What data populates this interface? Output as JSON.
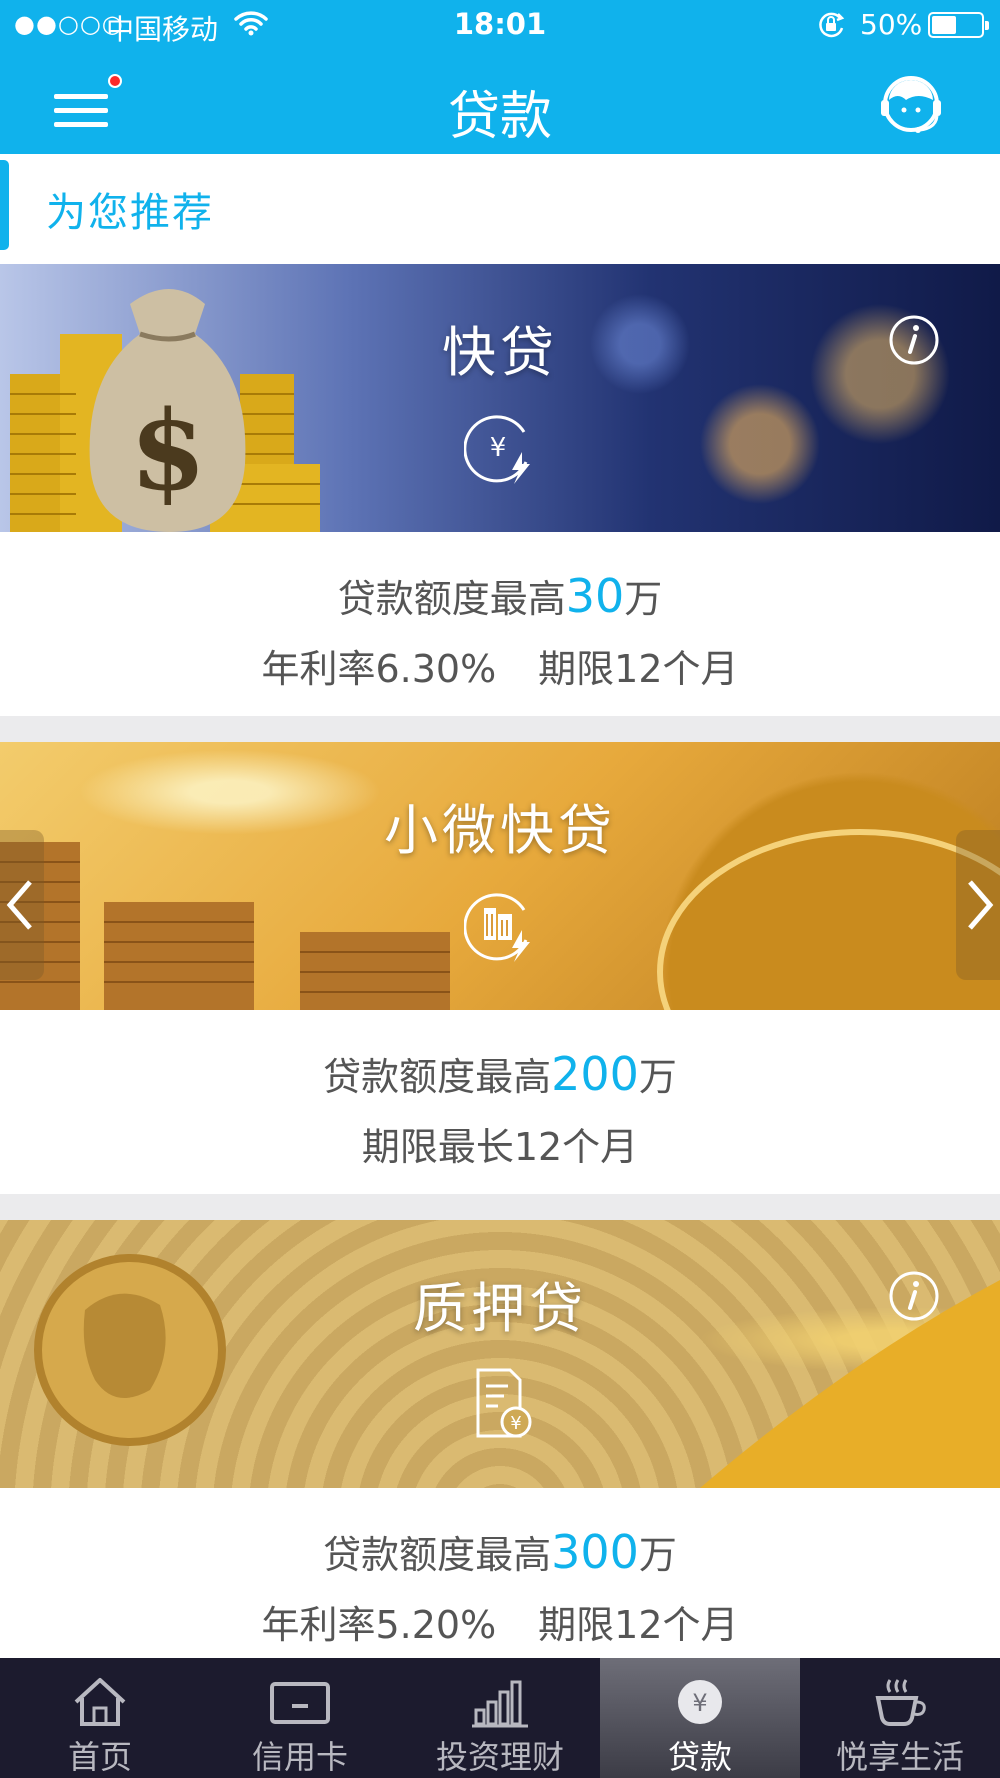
{
  "status_bar": {
    "signal": "●●○○○",
    "carrier": "中国移动",
    "time": "18:01",
    "battery": "50%"
  },
  "nav": {
    "title": "贷款"
  },
  "section": {
    "label": "为您推荐"
  },
  "products": [
    {
      "name": "快贷",
      "amount_prefix": "贷款额度最高",
      "amount": "30",
      "amount_unit": "万",
      "rate": "年利率6.30%",
      "term": "期限12个月"
    },
    {
      "name": "小微快贷",
      "amount_prefix": "贷款额度最高",
      "amount": "200",
      "amount_unit": "万",
      "term": "期限最长12个月"
    },
    {
      "name": "质押贷",
      "amount_prefix": "贷款额度最高",
      "amount": "300",
      "amount_unit": "万",
      "rate": "年利率5.20%",
      "term": "期限12个月"
    }
  ],
  "tabs": [
    {
      "label": "首页",
      "icon": "home-icon"
    },
    {
      "label": "信用卡",
      "icon": "credit-card-icon"
    },
    {
      "label": "投资理财",
      "icon": "bar-chart-icon"
    },
    {
      "label": "贷款",
      "icon": "yuan-coin-icon",
      "active": true
    },
    {
      "label": "悦享生活",
      "icon": "coffee-cup-icon"
    }
  ],
  "colors": {
    "brand": "#10b2ec",
    "tab_bar": "#1c1b2e",
    "divider": "#ebebed"
  }
}
